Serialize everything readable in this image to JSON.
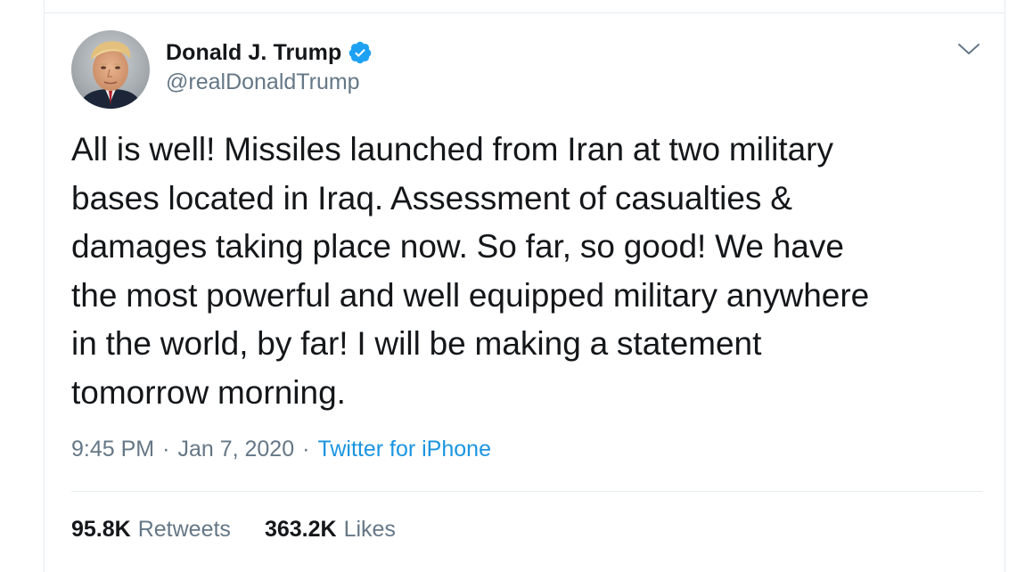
{
  "tweet": {
    "author": {
      "display_name": "Donald J. Trump",
      "handle": "@realDonaldTrump",
      "verified": true,
      "avatar_icon": "user-avatar-photo",
      "verified_icon": "verified-badge-icon"
    },
    "text": "All is well! Missiles launched from Iran at two military\nbases located in Iraq. Assessment of casualties &\ndamages taking place now. So far, so good! We have\nthe most powerful and well equipped military anywhere\nin the world, by far! I will be making a statement\ntomorrow morning.",
    "time": "9:45 PM",
    "separator": "·",
    "date": "Jan 7, 2020",
    "source": "Twitter for iPhone",
    "menu_icon": "chevron-down-icon"
  },
  "stats": {
    "retweets_count": "95.8K",
    "retweets_label": "Retweets",
    "likes_count": "363.2K",
    "likes_label": "Likes"
  },
  "colors": {
    "text_primary": "#14171a",
    "text_secondary": "#657786",
    "link": "#1b95e0",
    "verified": "#1da1f2",
    "border": "#e6ecf0"
  }
}
